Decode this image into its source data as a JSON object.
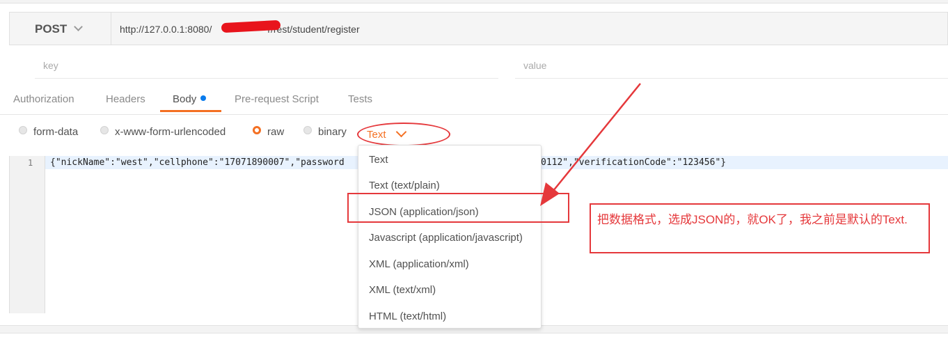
{
  "request": {
    "method": "POST",
    "url_prefix": "http://127.0.0.1:8080/",
    "url_suffix": "r/rest/student/register"
  },
  "params": {
    "key_placeholder": "key",
    "value_placeholder": "value"
  },
  "tabs": [
    "Authorization",
    "Headers",
    "Body",
    "Pre-request Script",
    "Tests"
  ],
  "body_options": [
    "form-data",
    "x-www-form-urlencoded",
    "raw",
    "binary"
  ],
  "selected_format": "Text",
  "editor": {
    "line_number": "1",
    "code_left": "{\"nickName\":\"west\",\"cellphone\":\"17071890007\",\"password",
    "code_right": "0112\",\"verificationCode\":\"123456\"}"
  },
  "format_options": [
    "Text",
    "Text (text/plain)",
    "JSON (application/json)",
    "Javascript (application/javascript)",
    "XML (application/xml)",
    "XML (text/xml)",
    "HTML (text/html)"
  ],
  "annotation": {
    "text": "把数据格式，选成JSON的，就OK了，我之前是默认的Text."
  },
  "colors": {
    "accent": "#f47023",
    "annotation_red": "#e5383b",
    "body_dot": "#097bed"
  }
}
